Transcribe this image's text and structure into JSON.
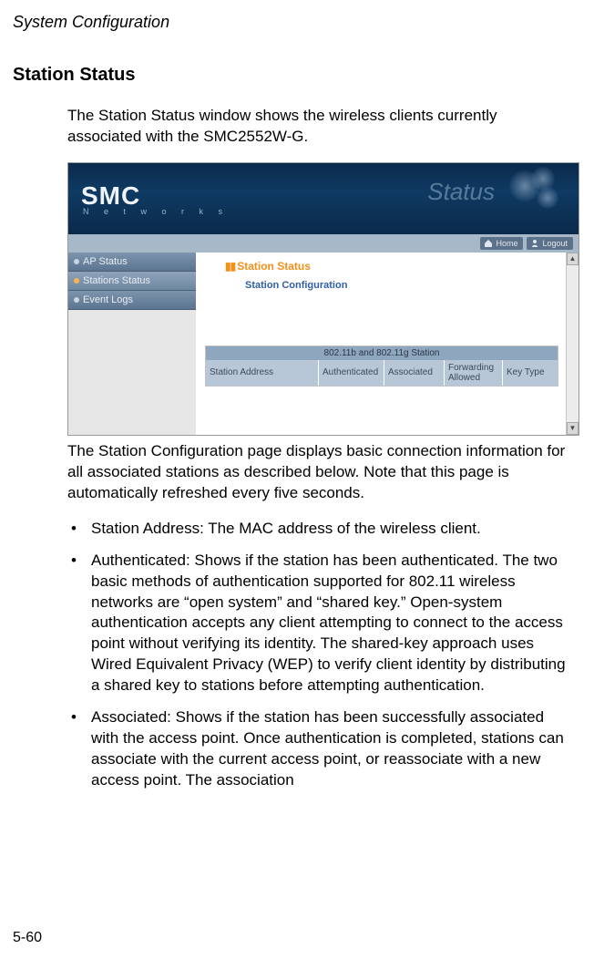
{
  "header": {
    "running_title": "System Configuration"
  },
  "section": {
    "title": "Station Status"
  },
  "intro": "The Station Status window shows the wireless clients currently associated with the SMC2552W-G.",
  "screenshot": {
    "logo_main": "SMC",
    "logo_sub": "N e t w o r k s",
    "banner_label": "Status",
    "toolbar": {
      "home": "Home",
      "logout": "Logout"
    },
    "sidebar": [
      {
        "label": "AP Status"
      },
      {
        "label": "Stations Status"
      },
      {
        "label": "Event Logs"
      }
    ],
    "main": {
      "heading": "Station Status",
      "subheading": "Station Configuration",
      "table_caption": "802.11b and 802.11g Station",
      "columns": [
        "Station Address",
        "Authenticated",
        "Associated",
        "Forwarding Allowed",
        "Key Type"
      ]
    }
  },
  "post_screenshot": "The Station Configuration page displays basic connection information for all associated stations as described below. Note that this page is automatically refreshed every five seconds.",
  "bullets": [
    "Station Address: The MAC address of the wireless client.",
    "Authenticated: Shows if the station has been authenticated. The two basic methods of authentication supported for 802.11 wireless networks are “open system” and “shared key.” Open-system authentication accepts any client attempting to connect to the access point without verifying its identity. The shared-key approach uses Wired Equivalent Privacy (WEP) to verify client identity by distributing a shared key to stations before attempting authentication.",
    "Associated: Shows if the station has been successfully associated with the access point. Once authentication is completed, stations can associate with the current access point, or reassociate with a new access point. The association"
  ],
  "page_number": "5-60"
}
